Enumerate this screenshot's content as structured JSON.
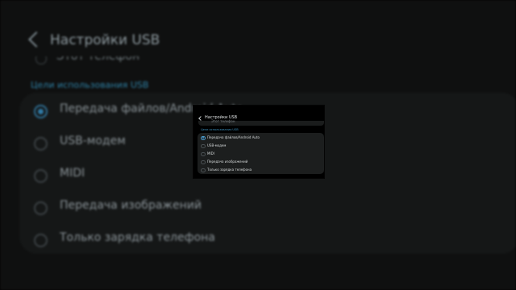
{
  "header": {
    "title": "Настройки USB",
    "back_icon": "chevron-left-icon"
  },
  "previous_option": {
    "label": "Этот телефон"
  },
  "section": {
    "title": "Цели использования USB"
  },
  "options": [
    {
      "label": "Передача файлов/Android Auto",
      "selected": true
    },
    {
      "label": "USB-модем",
      "selected": false
    },
    {
      "label": "MIDI",
      "selected": false
    },
    {
      "label": "Передача изображений",
      "selected": false
    },
    {
      "label": "Только зарядка телефона",
      "selected": false
    }
  ],
  "colors": {
    "accent": "#3a8fbb",
    "background": "#000000",
    "card": "#1c1e1e",
    "text": "#d6dadb"
  }
}
